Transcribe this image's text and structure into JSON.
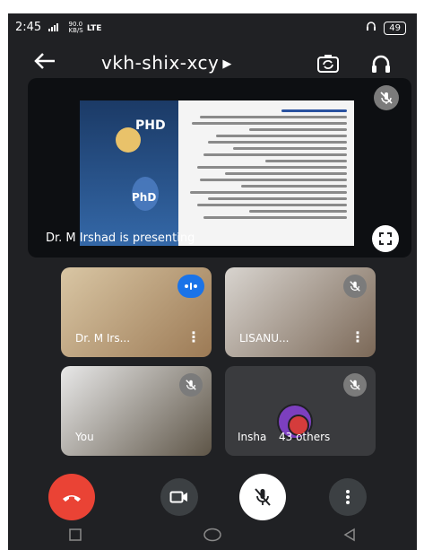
{
  "status": {
    "time": "2:45",
    "signal": "°°″″″",
    "net_speed": "90.0",
    "net_unit": "KB/S",
    "network": "LTE",
    "battery": "49"
  },
  "meeting": {
    "code": "vkh-shix-xcy",
    "caret": "▶"
  },
  "presentation": {
    "label": "Dr. M Irshad is presenting",
    "slide_texts": [
      "PHD",
      "PhD"
    ]
  },
  "participants": [
    {
      "name": "Dr. M Irs...",
      "status": "speaking"
    },
    {
      "name": "LISANU...",
      "status": "muted"
    },
    {
      "name": "You",
      "status": "muted"
    },
    {
      "name": "Insha",
      "status": "muted"
    }
  ],
  "others": {
    "label": "43 others"
  },
  "controls": {
    "end_call": "end-call",
    "camera": "camera",
    "mic": "mic-off",
    "more": "more"
  },
  "colors": {
    "background": "#202124",
    "end_call": "#ea4335",
    "speaking": "#1a73e8"
  }
}
